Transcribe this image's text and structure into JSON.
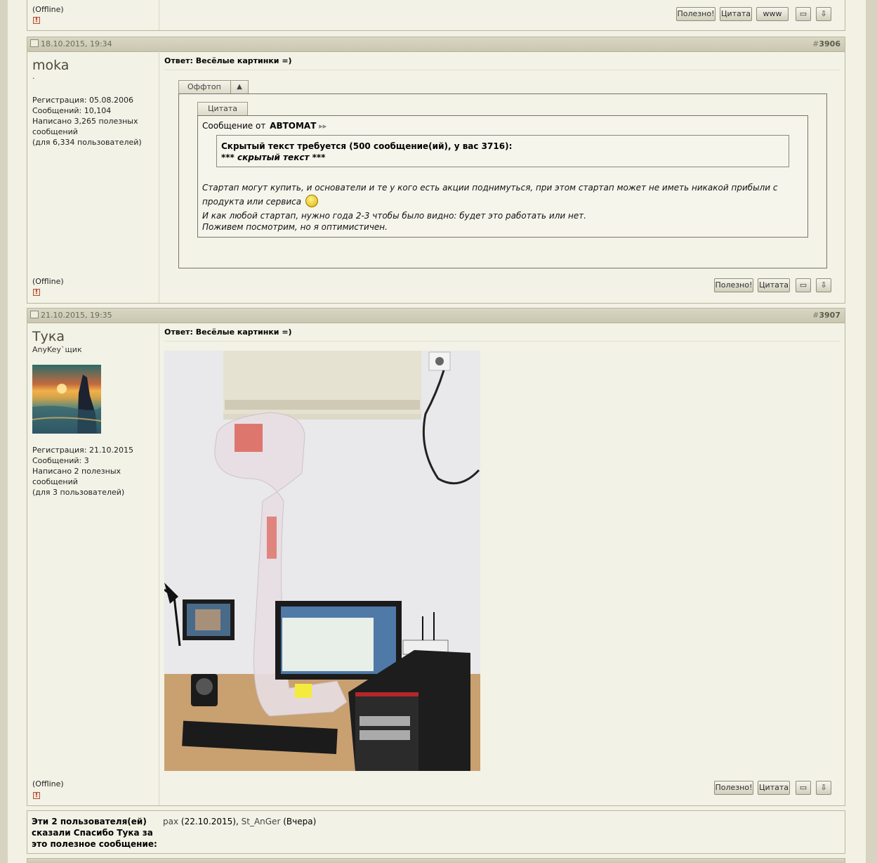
{
  "prev_post": {
    "offline": "(Offline)"
  },
  "buttons": {
    "useful": "Полезно!",
    "quote": "Цитата",
    "www": "www"
  },
  "post_3906": {
    "date": "18.10.2015, 19:34",
    "number_hash": "#",
    "number": "3906",
    "username": "moka",
    "usertitle": "·",
    "reg": "Регистрация: 05.08.2006",
    "messages": "Сообщений: 10,104",
    "useful_line1": "Написано 3,265 полезных",
    "useful_line2": "сообщений",
    "useful_line3": "(для 6,334 пользователей)",
    "title": "Ответ: Весёлые картинки =)",
    "spoiler_label": "Оффтоп",
    "spoiler_toggle": "▲",
    "quote_tab": "Цитата",
    "quote_from": "Сообщение от",
    "quote_author": "АВТОМАТ",
    "hidden_line1": "Скрытый текст требуется (500 сообщение(ий), у вас 3716):",
    "hidden_line2": "*** скрытый текст ***",
    "text1": "Стартап могут купить, и основатели и те у кого есть акции поднимуться, при этом стартап может не иметь никакой прибыли с",
    "text2": "продукта или сервиса",
    "text3": "И как любой стартап, нужно года 2-3 чтобы было видно: будет это работать или нет.",
    "text4": "Поживем посмотрим, но я оптимистичен.",
    "offline": "(Offline)"
  },
  "post_3907": {
    "date": "21.10.2015, 19:35",
    "number_hash": "#",
    "number": "3907",
    "username": "Тука",
    "usertitle": "AnyKey`щик",
    "reg": "Регистрация: 21.10.2015",
    "messages": "Сообщений: 3",
    "useful_line1": "Написано 2 полезных",
    "useful_line2": "сообщений",
    "useful_line3": "(для 3 пользователей)",
    "title": "Ответ: Весёлые картинки =)",
    "offline": "(Offline)"
  },
  "thanks": {
    "line1": "Эти 2 пользователя(ей)",
    "line2": "сказали Спасибо Тука за",
    "line3": "это полезное сообщение:",
    "user1": "pax",
    "date1": "(22.10.2015),",
    "user2": "St_AnGer",
    "date2": "(Вчера)"
  }
}
